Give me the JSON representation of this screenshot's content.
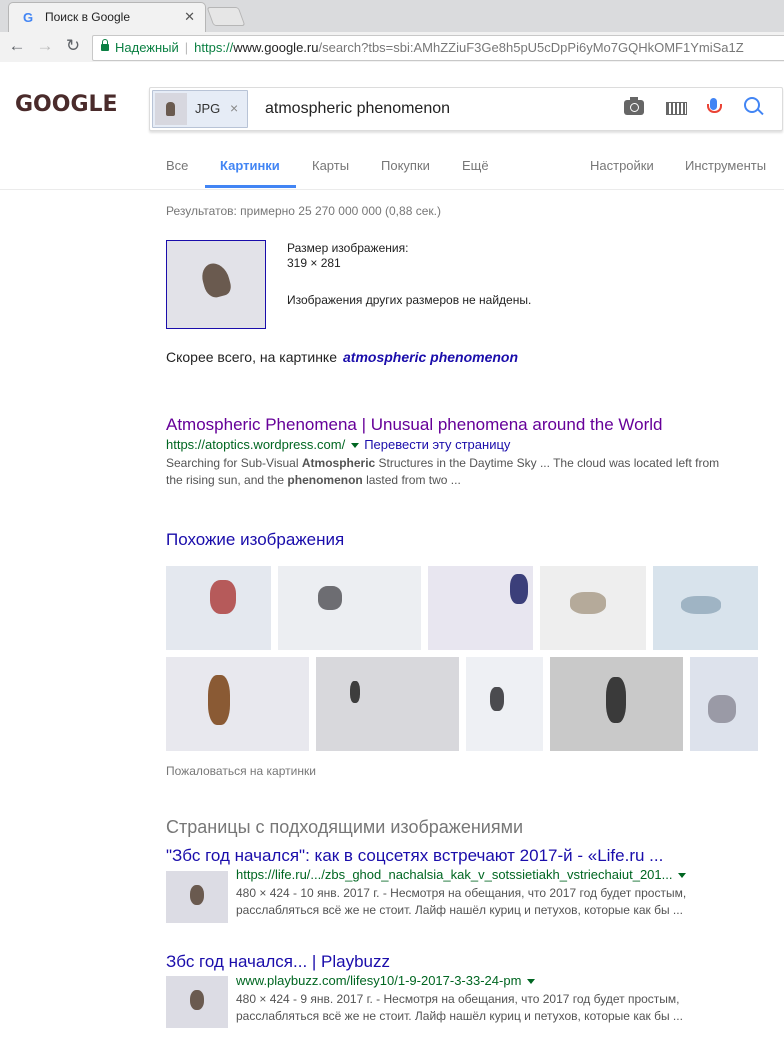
{
  "browser": {
    "tab_title": "Поиск в Google",
    "secure_label": "Надежный",
    "url_scheme": "https://",
    "url_host": "www.google.ru",
    "url_rest": "/search?tbs=sbi:AMhZZiuF3Ge8h5pU5cDpPi6yMo7GQHkOMF1YmiSa1Z"
  },
  "header": {
    "logo": "GOOGLE",
    "chip_label": "JPG",
    "query": "atmospheric phenomenon"
  },
  "tabs": {
    "all": "Все",
    "images": "Картинки",
    "maps": "Карты",
    "shopping": "Покупки",
    "more": "Ещё",
    "settings": "Настройки",
    "tools": "Инструменты"
  },
  "results": {
    "stats": "Результатов: примерно 25 270 000 000 (0,88 сек.)",
    "image_size_label": "Размер изображения:",
    "image_size": "319 × 281",
    "no_other_sizes": "Изображения других размеров не найдены.",
    "best_guess_prefix": "Скорее всего, на картинке",
    "best_guess": "atmospheric phenomenon",
    "first": {
      "title": "Atmospheric Phenomena | Unusual phenomena around the World",
      "url": "https://atoptics.wordpress.com/",
      "translate": "Перевести эту страницу",
      "snippet_1": "Searching for Sub-Visual ",
      "snippet_bold_1": "Atmospheric",
      "snippet_2": " Structures in the Daytime Sky ... The cloud was located left from",
      "snippet_3": "the rising sun, and the ",
      "snippet_bold_2": "phenomenon",
      "snippet_4": " lasted from two ..."
    },
    "similar_title": "Похожие изображения",
    "report": "Пожаловаться на картинки",
    "pages_title": "Страницы с подходящими изображениями",
    "pages": [
      {
        "title": "\"Збс год начался\": как в соцсетях встречают 2017-й - «Life.ru ...",
        "url": "https://life.ru/.../zbs_ghod_nachalsia_kak_v_sotssietiakh_vstriechaiut_201...",
        "meta": "480 × 424 - 10 янв. 2017 г. - Несмотря на обещания, что 2017 год будет простым,",
        "snippet": "расслабляться всё же не стоит. Лайф нашёл куриц и петухов, которые как бы ..."
      },
      {
        "title": "Збс год начался... | Playbuzz",
        "url": "www.playbuzz.com/lifesy10/1-9-2017-3-33-24-pm",
        "meta": "480 × 424 - 9 янв. 2017 г. - Несмотря на обещания, что 2017 год будет простым,",
        "snippet": "расслабляться всё же не стоит. Лайф нашёл куриц и петухов, которые как бы ..."
      }
    ]
  }
}
